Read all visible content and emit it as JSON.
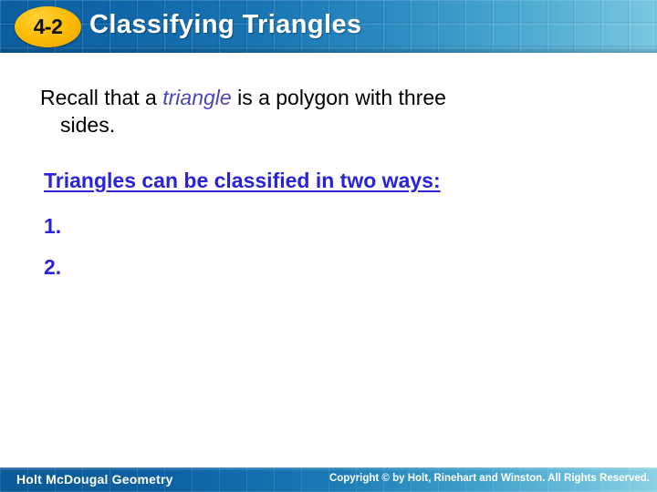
{
  "header": {
    "lesson_number": "4-2",
    "title": "Classifying Triangles",
    "background_start_color": "#0d5f9e",
    "background_end_color": "#7ac8e2",
    "badge_color": "#fcbe08",
    "title_color": "#ffffff"
  },
  "body": {
    "recall_line1_prefix": "Recall that a ",
    "recall_term": "triangle",
    "recall_line1_suffix": " is a polygon with three",
    "recall_line2": "sides.",
    "classify_heading": "Triangles can be classified in two ways:",
    "list_items": [
      {
        "marker": "1.",
        "text": ""
      },
      {
        "marker": "2.",
        "text": ""
      }
    ],
    "term_color": "#4a46b8",
    "heading_color": "#2a23d8",
    "text_color": "#000000"
  },
  "footer": {
    "book_title": "Holt McDougal Geometry",
    "copyright": "Copyright © by Holt, Rinehart and Winston. All Rights Reserved.",
    "background_start_color": "#0b5a97",
    "background_end_color": "#8ed2e6",
    "text_color": "#ffffff"
  }
}
